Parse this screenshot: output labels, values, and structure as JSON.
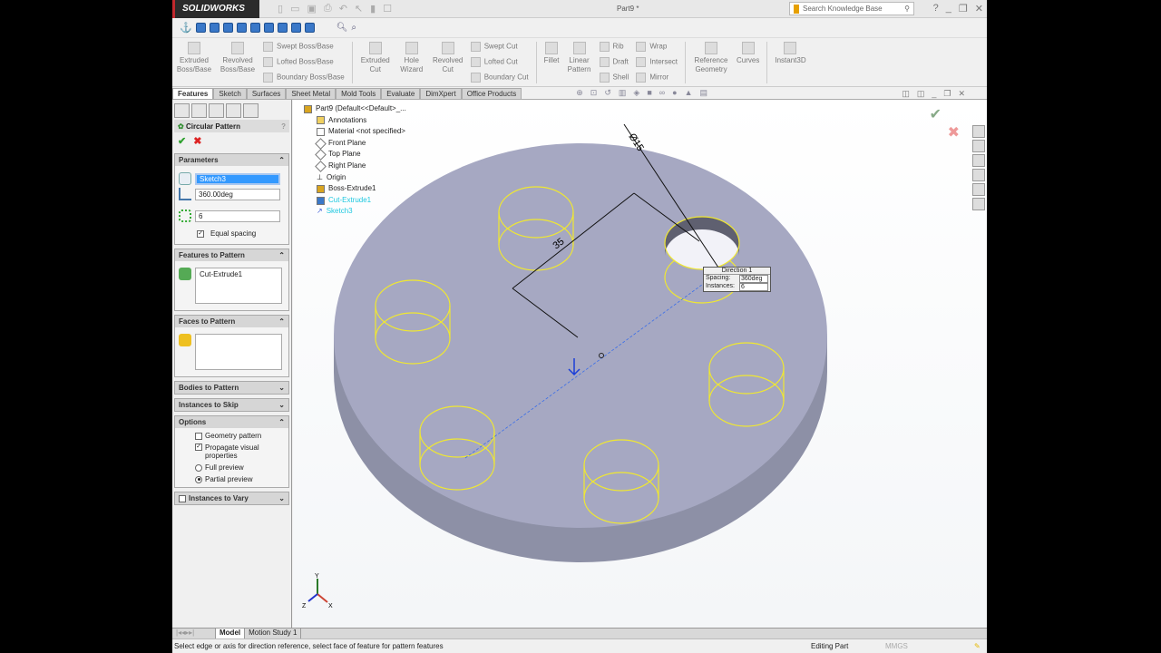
{
  "app": {
    "name": "SOLIDWORKS",
    "document_title": "Part9 *",
    "search_placeholder": "Search Knowledge Base"
  },
  "ribbon": {
    "extruded_boss": "Extruded Boss/Base",
    "revolved_boss": "Revolved Boss/Base",
    "swept_boss": "Swept Boss/Base",
    "lofted_boss": "Lofted Boss/Base",
    "boundary_boss": "Boundary Boss/Base",
    "extruded_cut": "Extruded Cut",
    "hole_wizard": "Hole Wizard",
    "revolved_cut": "Revolved Cut",
    "swept_cut": "Swept Cut",
    "lofted_cut": "Lofted Cut",
    "boundary_cut": "Boundary Cut",
    "fillet": "Fillet",
    "linear_pattern": "Linear Pattern",
    "rib": "Rib",
    "draft": "Draft",
    "shell": "Shell",
    "wrap": "Wrap",
    "intersect": "Intersect",
    "mirror": "Mirror",
    "reference_geometry": "Reference Geometry",
    "curves": "Curves",
    "instant3d": "Instant3D"
  },
  "tabs": [
    "Features",
    "Sketch",
    "Surfaces",
    "Sheet Metal",
    "Mold Tools",
    "Evaluate",
    "DimXpert",
    "Office Products"
  ],
  "property_manager": {
    "title": "Circular Pattern",
    "help": "?",
    "parameters": {
      "header": "Parameters",
      "axis": "Sketch3",
      "angle": "360.00deg",
      "instances": "6",
      "equal_spacing": "Equal spacing"
    },
    "features": {
      "header": "Features to Pattern",
      "item": "Cut-Extrude1"
    },
    "faces": {
      "header": "Faces to Pattern"
    },
    "bodies": {
      "header": "Bodies to Pattern"
    },
    "skip": {
      "header": "Instances to Skip"
    },
    "options": {
      "header": "Options",
      "geometry_pattern": "Geometry pattern",
      "propagate": "Propagate visual properties",
      "full_preview": "Full preview",
      "partial_preview": "Partial preview"
    },
    "vary": {
      "header": "Instances to Vary"
    }
  },
  "tree": {
    "root": "Part9  (Default<<Default>_...",
    "items": [
      "Annotations",
      "Material <not specified>",
      "Front Plane",
      "Top Plane",
      "Right Plane",
      "Origin",
      "Boss-Extrude1",
      "Cut-Extrude1",
      "Sketch3"
    ]
  },
  "viewport": {
    "dim_radius": "35",
    "dim_diameter": "Ø15",
    "callout": {
      "title": "Direction 1",
      "spacing_label": "Spacing:",
      "spacing": "360deg",
      "instances_label": "Instances:",
      "instances": "6"
    },
    "axes": {
      "x": "X",
      "y": "Y",
      "z": "Z"
    }
  },
  "bottom_tabs": [
    "Model",
    "Motion Study 1"
  ],
  "status": {
    "message": "Select edge or axis for direction reference, select face of feature for pattern features",
    "mode": "Editing Part",
    "units": "MMGS"
  }
}
